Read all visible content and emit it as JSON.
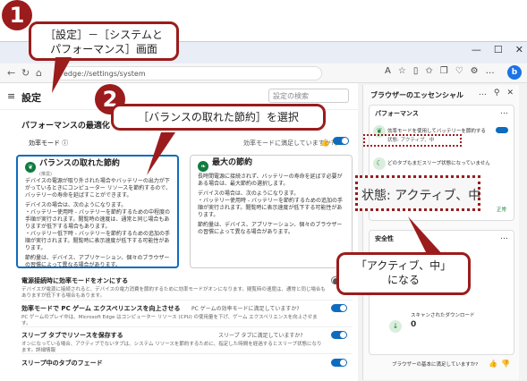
{
  "annotations": {
    "step1_number": "1",
    "step1_text_line1": "［設定］－［システムと",
    "step1_text_line2": "パフォーマンス］画面",
    "step2_number": "2",
    "step2_text": "［バランスの取れた節約］を選択",
    "result_text_line1": "「アクティブ、中」",
    "result_text_line2": "になる",
    "zoom_text": "状態: アクティブ、中"
  },
  "browser": {
    "address": "edge://settings/system",
    "win_min": "—",
    "win_max": "☐",
    "win_close": "✕",
    "copilot": "b"
  },
  "settings": {
    "title": "設定",
    "search_placeholder": "設定の検索",
    "section_title": "パフォーマンスの最適化",
    "efficiency_mode_label": "効率モード ⓘ",
    "efficiency_feedback": "効率モードに満足していますか?",
    "balanced": {
      "title": "バランスの取れた節約",
      "sub": "(推奨)",
      "body1": "デバイスの電源が取り外された場合やバッテリーの出力が下がっているときにコンピューター リソースを節約するので、バッテリーの寿命を延ばすことができます。",
      "body2": "デバイスの場合は、次のようになります。",
      "bullet1": "・バッテリー使用時 - バッテリーを節約するための中程度の手順が実行されます。閲覧時の速度は、通常と同じ場合もありますが低下する場合もあります。",
      "bullet2": "・バッテリー低下時 - バッテリーを節約するための追加の手順が実行されます。閲覧時に表示速度が低下する可能性があります。",
      "body3": "節約量は、デバイス、アプリケーション、個々のブラウザーの習慣によって異なる場合があります。"
    },
    "max": {
      "title": "最大の節約",
      "body1": "長時間電源に接続されず、バッテリーの寿命を延ばす必要がある場合は、最大節約の選択します。",
      "body2": "デバイスの場合は、次のようになります。",
      "bullet1": "・バッテリー使用時 - バッテリーを節約するための追加の手順が実行されます。閲覧時に表示速度が低下する可能性があります。",
      "body3": "節約量は、デバイス、アプリケーション、個々のブラウザーの習慣によって異なる場合があります。"
    },
    "rows": [
      {
        "title": "電源接続時に効率モードをオンにする",
        "desc": "デバイスが電源に接続されると、デバイスの電力消費を節約するために効率モードがオンになります。閲覧時の速度は、通常と同じ場合もありますが低下する場合もあります。",
        "feedback": ""
      },
      {
        "title": "効率モードで PC ゲーム エクスペリエンスを向上させる",
        "desc": "PC ゲームのプレイ中は、Microsoft Edge はコンピューター リソース (CPU) の使用量を下げ、ゲーム エクスペリエンスを向上させます。",
        "feedback": "PC ゲームの効率モードに満足していますか?"
      },
      {
        "title": "スリープ タブでリソースを保存する",
        "desc": "オンになっている場合、アクティブでないタブは、システム リソースを節約するために、指定した時間を経過するとスリープ状態になります。詳細情報",
        "feedback": "スリープ タブに満足していますか?"
      },
      {
        "title": "スリープ中のタブのフェード",
        "desc": "",
        "feedback": ""
      }
    ]
  },
  "side_panel": {
    "title": "ブラウザーのエッセンシャル",
    "perf_title": "パフォーマンス",
    "perf_line1": "効率モードを使用してバッテリーを節約する",
    "perf_status": "状態: アクティブ、中",
    "perf_line2": "どのタブもまだスリープ状態になっていません",
    "perf_footer": "パフォーマンス",
    "perf_ok": "正常",
    "security_title": "安全性",
    "download_label": "スキャンされたダウンロード",
    "download_count": "0",
    "footer_feedback": "ブラウザーの基本に満足していますか?"
  }
}
